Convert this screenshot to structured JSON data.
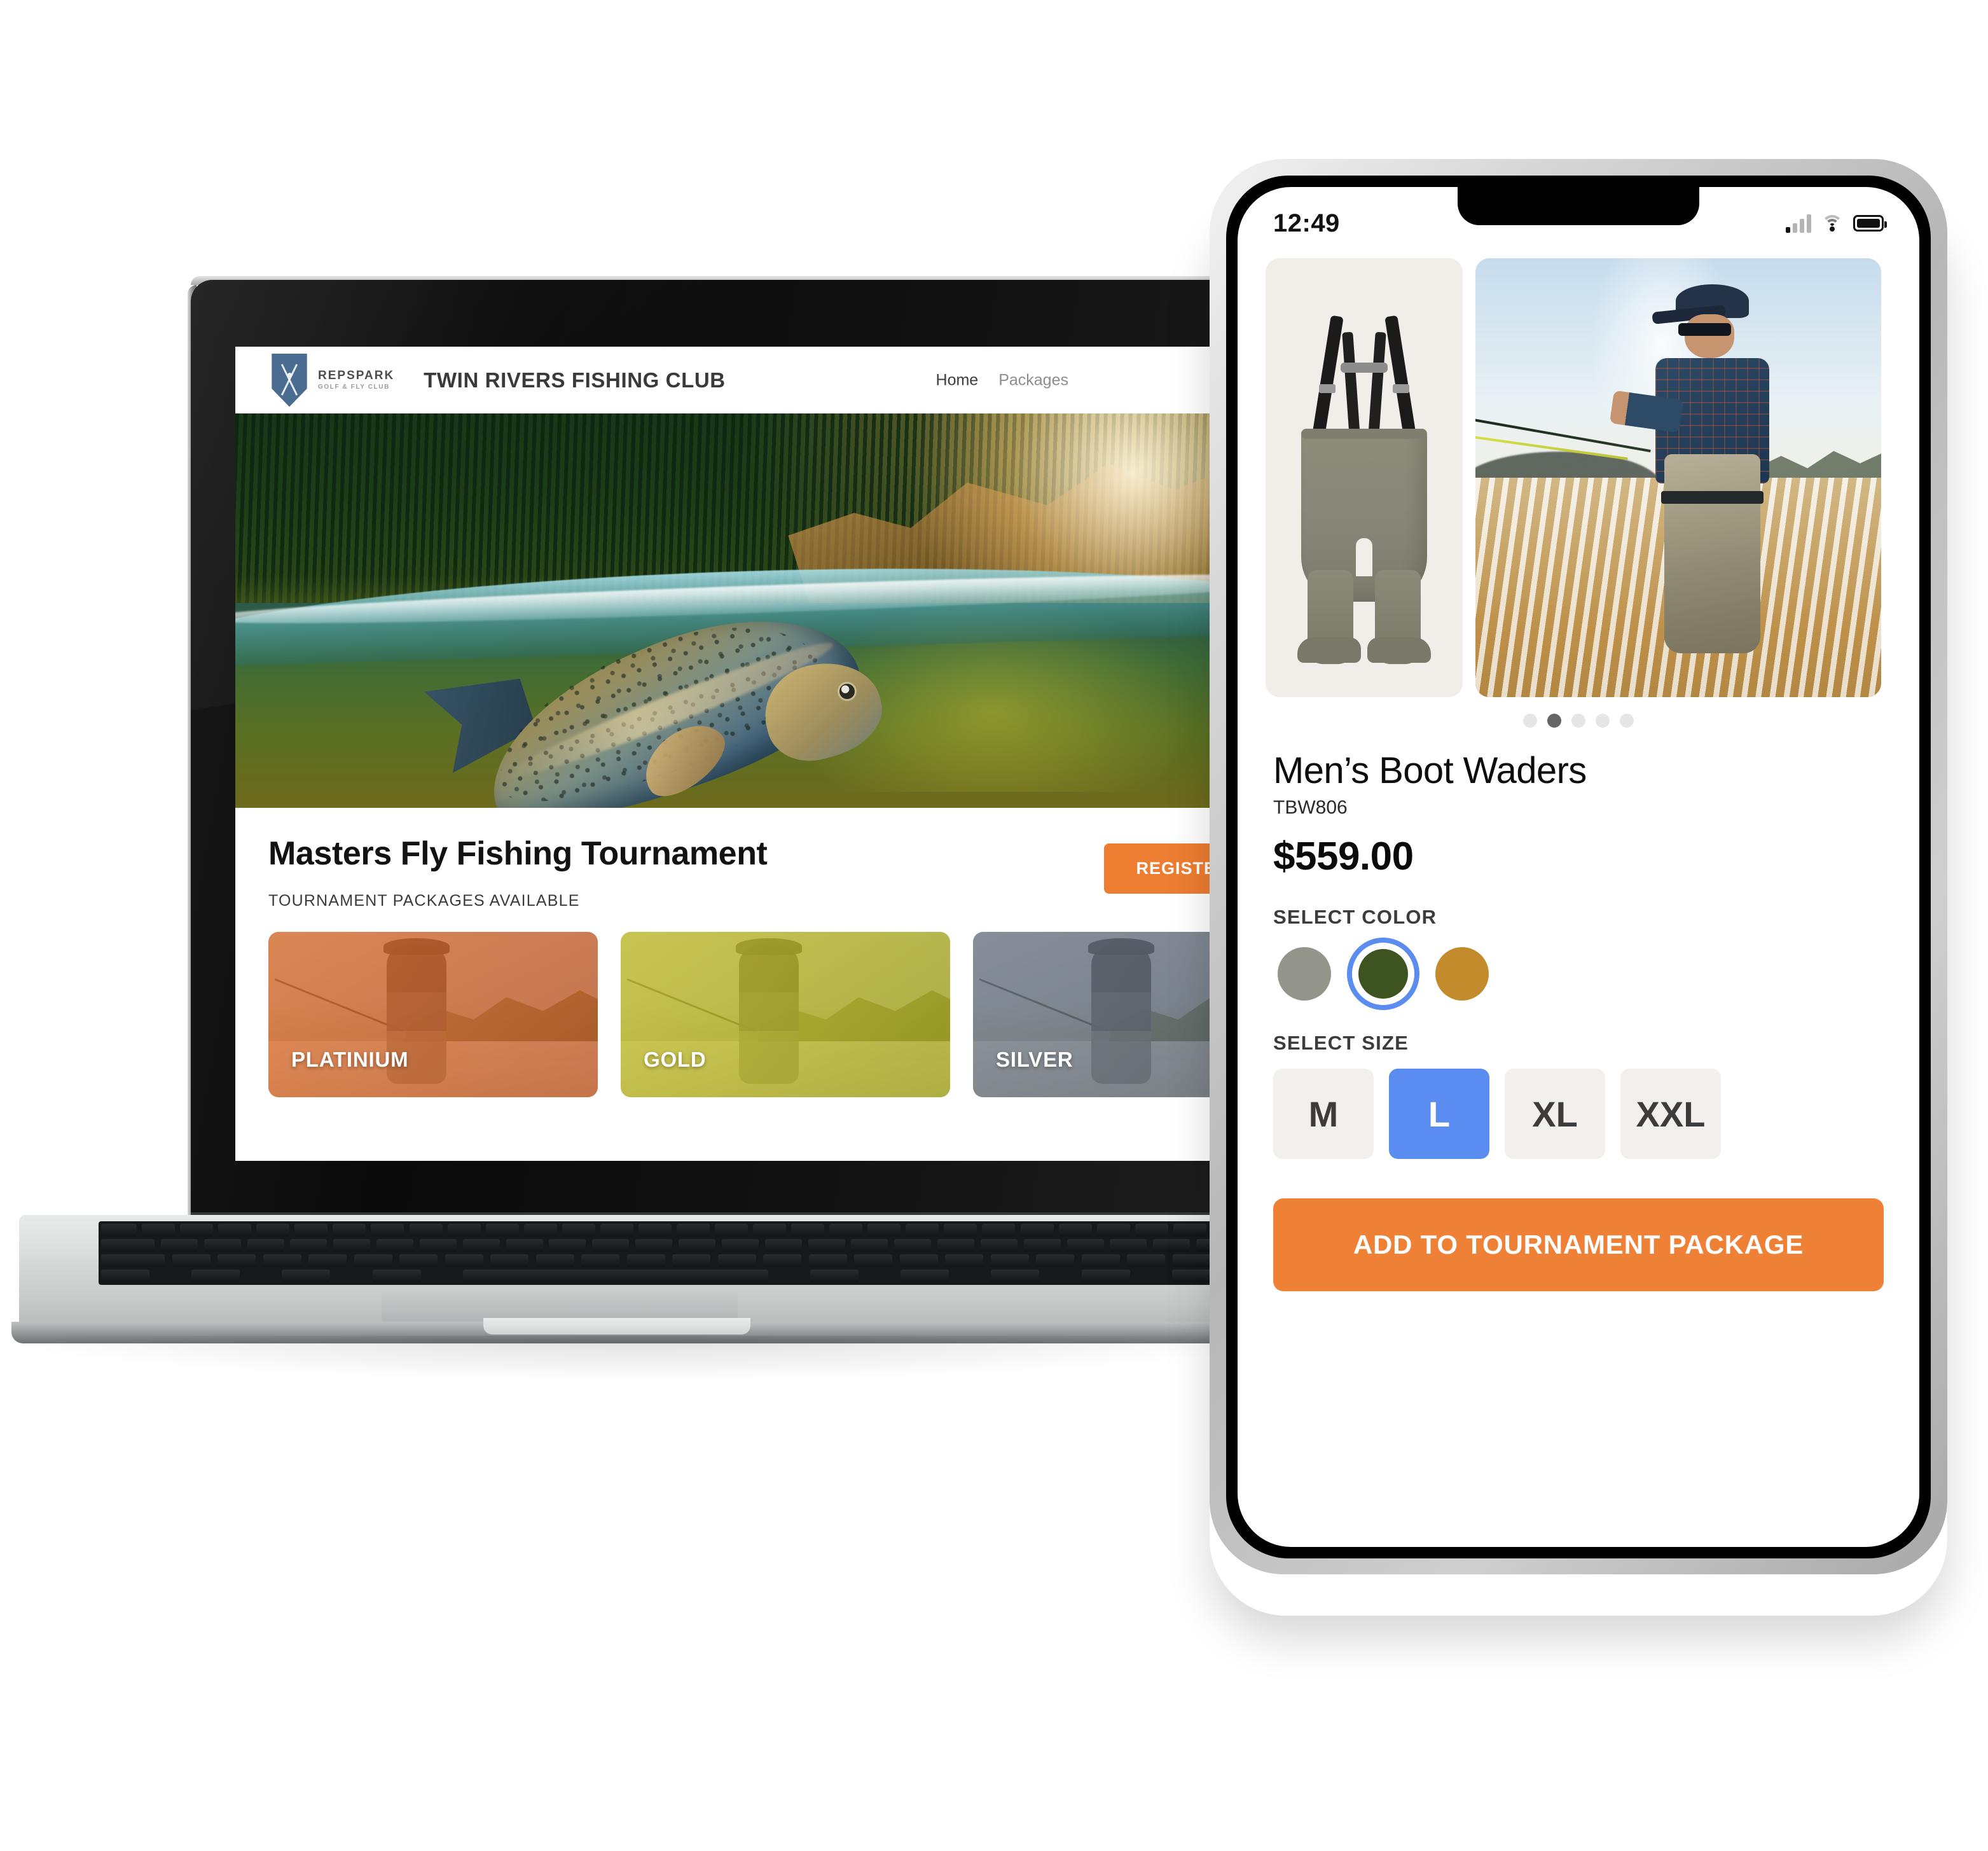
{
  "laptop": {
    "site": {
      "brand": {
        "logo_line1": "REPSPARK",
        "logo_line2": "GOLF & FLY CLUB",
        "title": "TWIN RIVERS FISHING CLUB",
        "shield_icon": "shield-crossed-rods-icon"
      },
      "nav": [
        {
          "label": "Home",
          "active": true
        },
        {
          "label": "Packages",
          "active": false
        }
      ],
      "hero": {
        "alt": "rainbow-trout-underwater-split-shot",
        "scene": "half-submerged river view with trout below waterline and sunlit forest cliff above"
      },
      "promo": {
        "title": "Masters Fly Fishing Tournament",
        "subtitle": "TOURNAMENT PACKAGES AVAILABLE",
        "register_label": "REGISTER HERE"
      },
      "packages": [
        {
          "label": "PLATINIUM",
          "tint": "#e0702d"
        },
        {
          "label": "GOLD",
          "tint": "#c9c12e"
        },
        {
          "label": "SILVER",
          "tint": "#6f7780"
        }
      ]
    }
  },
  "phone": {
    "status": {
      "time": "12:49",
      "signal_icon": "cellular-signal-icon",
      "wifi_icon": "wifi-icon",
      "battery_icon": "battery-full-icon"
    },
    "gallery": {
      "image_1_alt": "mens-boot-waders-product-shot",
      "image_2_alt": "angler-wearing-waders-in-river",
      "dots_total": 5,
      "dots_active_index": 1
    },
    "product": {
      "title": "Men’s Boot Waders",
      "sku": "TBW806",
      "price": "$559.00",
      "color_label": "SELECT COLOR",
      "colors": [
        {
          "name": "sage",
          "hex": "#94958a",
          "selected": false
        },
        {
          "name": "olive",
          "hex": "#3d5420",
          "selected": true
        },
        {
          "name": "bronze",
          "hex": "#c38b2c",
          "selected": false
        }
      ],
      "selection_ring_color": "#5b8cf0",
      "size_label": "SELECT SIZE",
      "sizes": [
        {
          "label": "M",
          "selected": false
        },
        {
          "label": "L",
          "selected": true
        },
        {
          "label": "XL",
          "selected": false
        },
        {
          "label": "XXL",
          "selected": false
        }
      ],
      "cta_label": "ADD TO TOURNAMENT PACKAGE",
      "cta_color": "#ef8136"
    }
  }
}
